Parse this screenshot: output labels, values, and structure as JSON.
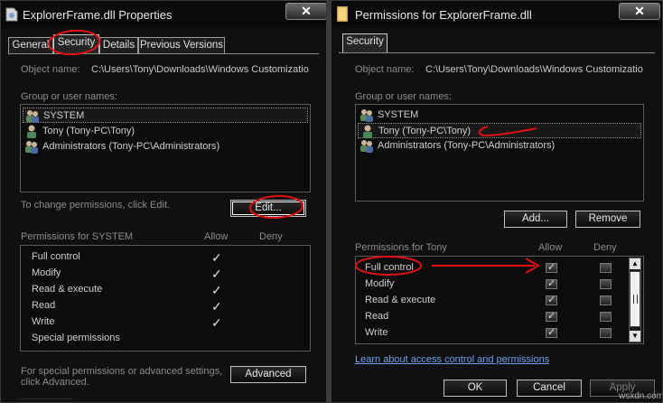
{
  "left_window": {
    "title": "ExplorerFrame.dll Properties",
    "close_glyph": "✕",
    "tabs": [
      {
        "label": "General",
        "active": false
      },
      {
        "label": "Security",
        "active": true
      },
      {
        "label": "Details",
        "active": false
      },
      {
        "label": "Previous Versions",
        "active": false
      }
    ],
    "object_name_label": "Object name:",
    "object_name_value": "C:\\Users\\Tony\\Downloads\\Windows Customizatio",
    "group_label": "Group or user names:",
    "users": [
      {
        "name": "SYSTEM",
        "selected": true,
        "icon": "group-users-icon"
      },
      {
        "name": "Tony (Tony-PC\\Tony)",
        "selected": false,
        "icon": "user-icon"
      },
      {
        "name": "Administrators (Tony-PC\\Administrators)",
        "selected": false,
        "icon": "group-users-icon"
      }
    ],
    "change_permissions_text": "To change permissions, click Edit.",
    "edit_button": "Edit...",
    "permissions_for_label": "Permissions for SYSTEM",
    "allow_label": "Allow",
    "deny_label": "Deny",
    "permissions": [
      {
        "name": "Full control",
        "allow": true,
        "deny": false
      },
      {
        "name": "Modify",
        "allow": true,
        "deny": false
      },
      {
        "name": "Read & execute",
        "allow": true,
        "deny": false
      },
      {
        "name": "Read",
        "allow": true,
        "deny": false
      },
      {
        "name": "Write",
        "allow": true,
        "deny": false
      },
      {
        "name": "Special permissions",
        "allow": false,
        "deny": false
      }
    ],
    "check_glyph": "✓",
    "advanced_text_line1": "For special permissions or advanced settings,",
    "advanced_text_line2": "click Advanced.",
    "advanced_button": "Advanced"
  },
  "right_window": {
    "title": "Permissions for ExplorerFrame.dll",
    "close_glyph": "✕",
    "tab_label": "Security",
    "object_name_label": "Object name:",
    "object_name_value": "C:\\Users\\Tony\\Downloads\\Windows Customizatio",
    "group_label": "Group or user names:",
    "users": [
      {
        "name": "SYSTEM",
        "selected": false,
        "icon": "group-users-icon"
      },
      {
        "name": "Tony (Tony-PC\\Tony)",
        "selected": true,
        "icon": "user-icon"
      },
      {
        "name": "Administrators (Tony-PC\\Administrators)",
        "selected": false,
        "icon": "group-users-icon"
      }
    ],
    "add_button": "Add...",
    "remove_button": "Remove",
    "permissions_for_label": "Permissions for Tony",
    "allow_label": "Allow",
    "deny_label": "Deny",
    "permissions": [
      {
        "name": "Full control",
        "allow": true,
        "deny": false
      },
      {
        "name": "Modify",
        "allow": true,
        "deny": false
      },
      {
        "name": "Read & execute",
        "allow": true,
        "deny": false
      },
      {
        "name": "Read",
        "allow": true,
        "deny": false
      },
      {
        "name": "Write",
        "allow": true,
        "deny": false
      }
    ],
    "scroll_up_glyph": "▲",
    "scroll_down_glyph": "▼",
    "link_text": "Learn about access control and permissions",
    "ok_button": "OK",
    "cancel_button": "Cancel",
    "apply_button": "Apply",
    "watermark": "wsxdn.com"
  },
  "colors": {
    "window_bg": "#101010",
    "link": "#6fa0f0",
    "annotation_red": "#e01010"
  }
}
